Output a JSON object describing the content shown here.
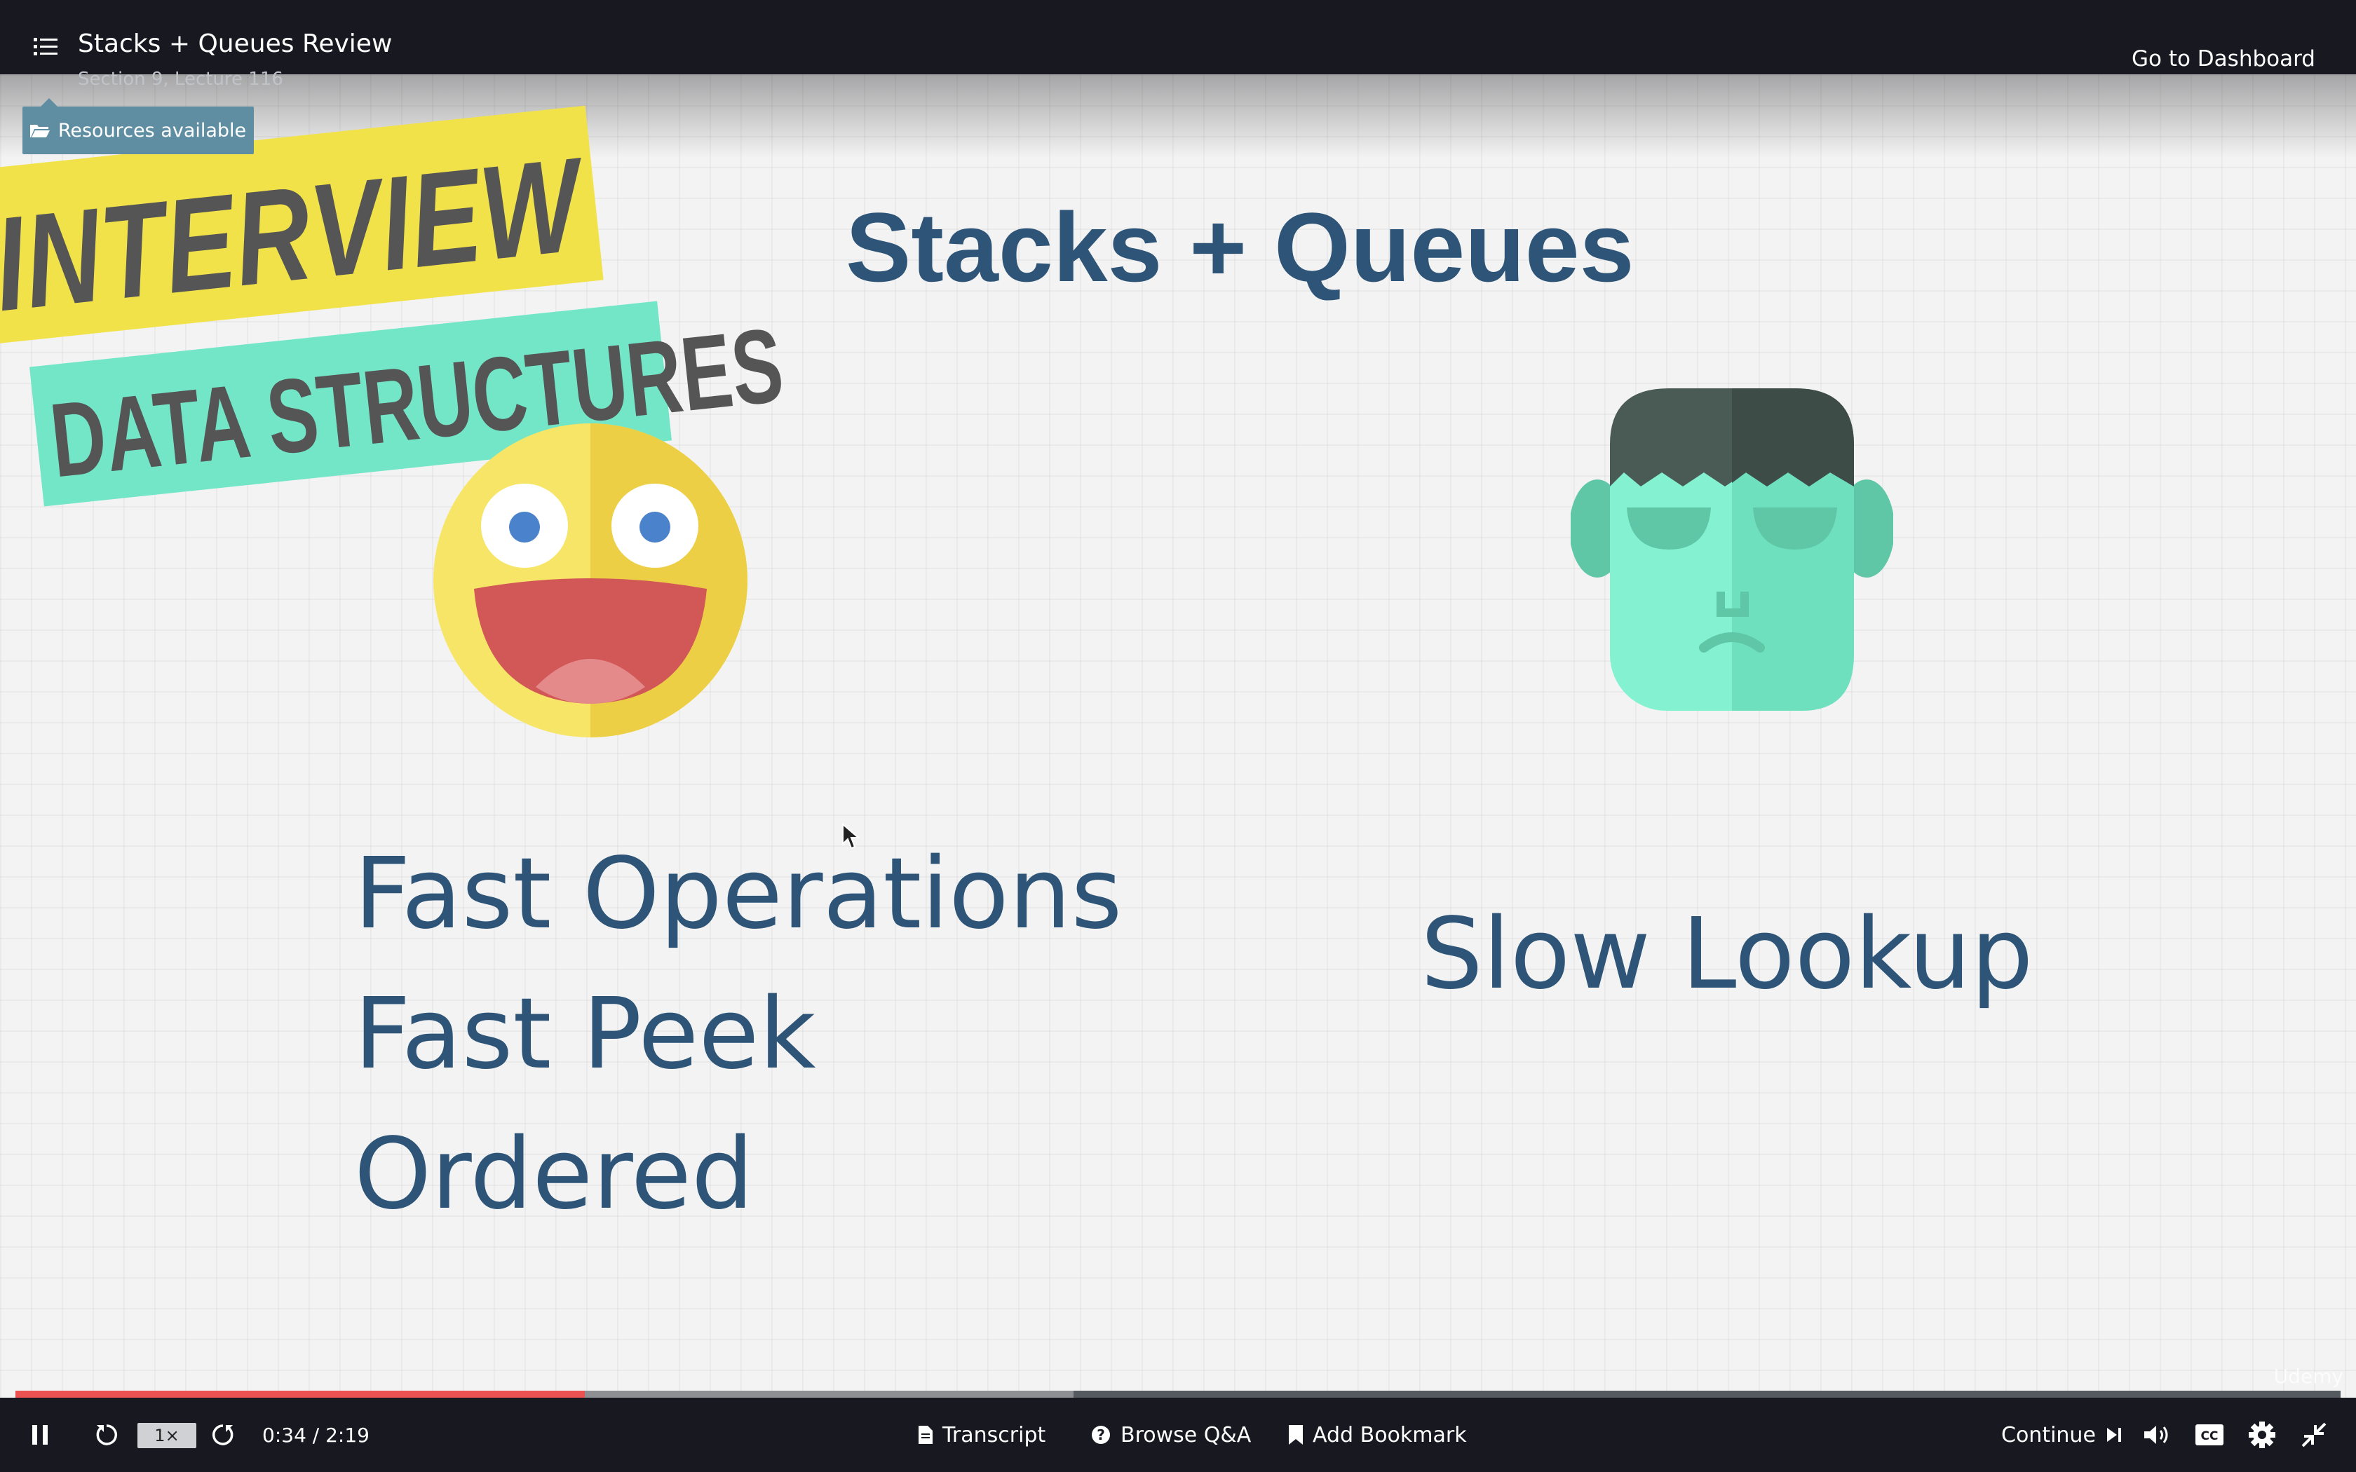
{
  "header": {
    "title": "Stacks + Queues Review",
    "subtitle": "Section 9, Lecture 116",
    "dashboard_link": "Go to Dashboard",
    "resources_label": "Resources available"
  },
  "slide": {
    "title": "Stacks + Queues",
    "badge_top": "INTERVIEW",
    "badge_bottom": "DATA STRUCTURES",
    "pros": [
      "Fast Operations",
      "Fast Peek",
      "Ordered"
    ],
    "cons": [
      "Slow Lookup"
    ],
    "watermark": "Udemy"
  },
  "player": {
    "speed": "1×",
    "time": "0:34 / 2:19",
    "progress_fraction": 0.245,
    "buffer_fraction": 0.455,
    "transcript_label": "Transcript",
    "qa_label": "Browse Q&A",
    "bookmark_label": "Add Bookmark",
    "continue_label": "Continue"
  },
  "colors": {
    "bar_background": "#171820",
    "accent_red": "#ec5252",
    "resources_bg": "#5f8ea3",
    "slide_text": "#2e5577"
  },
  "icons": [
    "menu-list-icon",
    "folder-open-icon",
    "pause-icon",
    "rewind-icon",
    "forward-icon",
    "document-icon",
    "question-circle-icon",
    "bookmark-icon",
    "skip-next-icon",
    "volume-icon",
    "cc-icon",
    "gear-icon",
    "exit-fullscreen-icon"
  ]
}
